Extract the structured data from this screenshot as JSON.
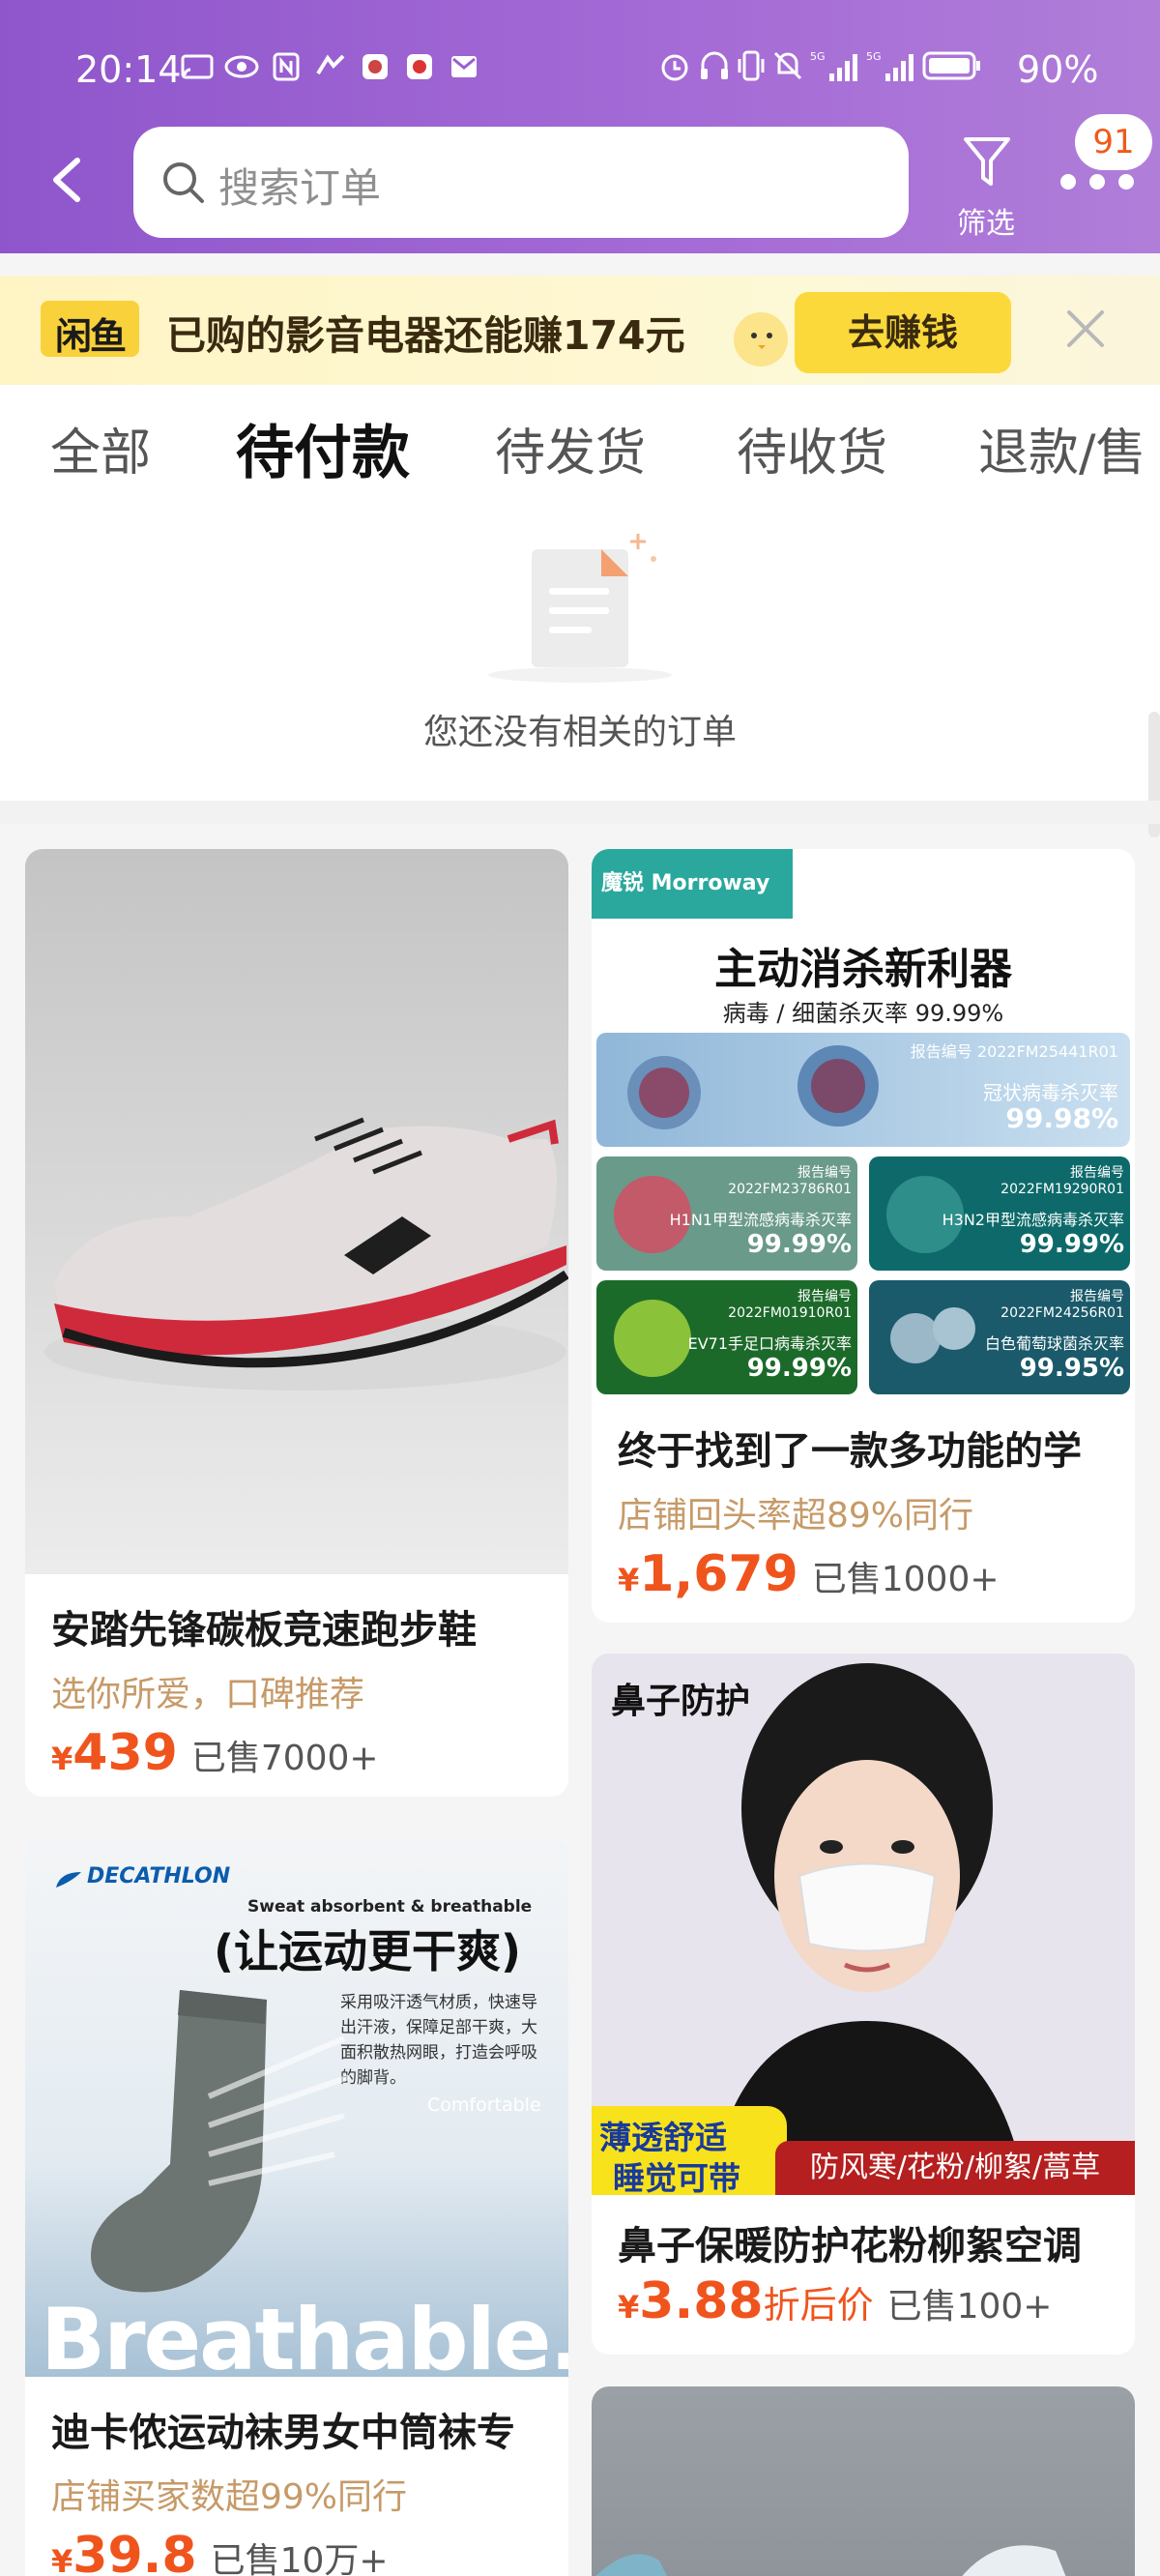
{
  "status_bar": {
    "time": "20:14",
    "battery": "90%"
  },
  "header": {
    "search_placeholder": "搜索订单",
    "filter_label": "筛选",
    "badge_count": "91"
  },
  "banner": {
    "logo_text": "闲鱼",
    "text": "已购的影音电器还能赚174元",
    "button_label": "去赚钱"
  },
  "tabs": [
    {
      "label": "全部"
    },
    {
      "label": "待付款"
    },
    {
      "label": "待发货"
    },
    {
      "label": "待收货"
    },
    {
      "label": "退款/售"
    }
  ],
  "empty_state": {
    "text": "您还没有相关的订单"
  },
  "products": [
    {
      "title": "安踏先锋碳板竞速跑步鞋",
      "tag": "选你所爱，口碑推荐",
      "currency": "¥",
      "price": "439",
      "sold": "已售7000+"
    },
    {
      "title": "终于找到了一款多功能的学",
      "tag": "店铺回头率超89%同行",
      "currency": "¥",
      "price": "1,679",
      "sold": "已售1000+",
      "image_text": {
        "brand": "魔锐 Morroway",
        "headline": "主动消杀新利器",
        "subline": "病毒 / 细菌杀灭率 99.99%",
        "cells": [
          {
            "code": "报告编号 2022FM25441R01",
            "label": "冠状病毒杀灭率",
            "value": "99.98%"
          },
          {
            "code": "报告编号 2022FM23786R01",
            "label": "H1N1甲型流感病毒杀灭率",
            "value": "99.99%"
          },
          {
            "code": "报告编号 2022FM19290R01",
            "label": "H3N2甲型流感病毒杀灭率",
            "value": "99.99%"
          },
          {
            "code": "报告编号 2022FM01910R01",
            "label": "EV71手足口病毒杀灭率",
            "value": "99.99%"
          },
          {
            "code": "报告编号 2022FM24256R01",
            "label": "白色葡萄球菌杀灭率",
            "value": "99.95%"
          }
        ]
      }
    },
    {
      "title": "鼻子保暖防护花粉柳絮空调",
      "tag": "",
      "currency": "¥",
      "price": "3.88",
      "discount": "折后价",
      "sold": "已售100+",
      "image_text": {
        "top": "鼻子防护",
        "left1": "薄透舒适",
        "left2": "睡觉可带",
        "right": "防风寒/花粉/柳絮/蒿草"
      }
    },
    {
      "title": "迪卡侬运动袜男女中筒袜专",
      "tag": "店铺买家数超99%同行",
      "currency": "¥",
      "price": "39.8",
      "sold": "已售10万+",
      "image_text": {
        "brand": "DECATHLON",
        "sub": "Sweat absorbent & breathable",
        "headline": "(让运动更干爽)",
        "desc": "采用吸汗透气材质，快速导出汗液，保障足部干爽，大面积散热网眼，打造会呼吸的脚背。",
        "side": "Comfortable",
        "big": "Breathable."
      }
    }
  ],
  "colors": {
    "header": "#9b5fd2",
    "price": "#f0541d",
    "banner_button": "#fbd93a",
    "tag": "#c69a68"
  }
}
